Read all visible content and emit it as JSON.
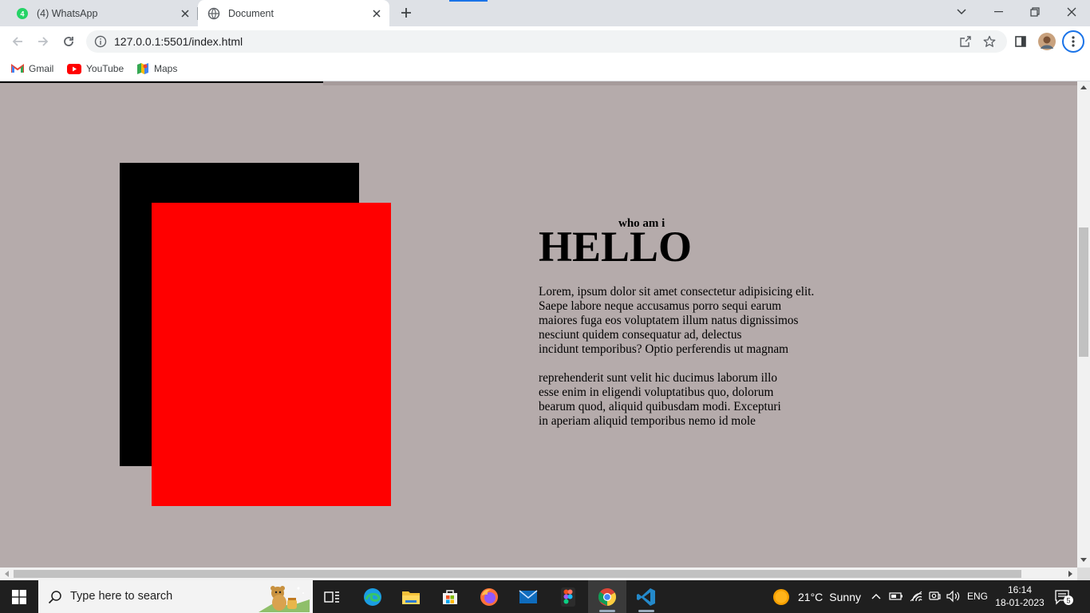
{
  "browser": {
    "tabs": [
      {
        "label": "(4) WhatsApp",
        "icon": "whatsapp-icon",
        "active": false
      },
      {
        "label": "Document",
        "icon": "globe-icon",
        "active": true
      }
    ],
    "url": "127.0.0.1:5501/index.html",
    "bookmarks": [
      {
        "label": "Gmail",
        "icon": "gmail-icon"
      },
      {
        "label": "YouTube",
        "icon": "youtube-icon"
      },
      {
        "label": "Maps",
        "icon": "maps-icon"
      }
    ]
  },
  "page": {
    "background": "#b5abab",
    "box_back_color": "#000000",
    "box_front_color": "#ff0000",
    "subtitle": "who am i",
    "headline": "HELLO",
    "paragraph1": "Lorem, ipsum dolor sit amet consectetur adipisicing elit.\nSaepe labore neque accusamus porro sequi earum\nmaiores fuga eos voluptatem illum natus dignissimos\nnesciunt quidem consequatur ad, delectus\nincidunt temporibus? Optio perferendis ut magnam",
    "paragraph2": "reprehenderit sunt velit hic ducimus laborum illo\nesse enim in eligendi voluptatibus quo, dolorum\nbearum quod, aliquid quibusdam modi. Excepturi\nin aperiam aliquid temporibus nemo id mole"
  },
  "taskbar": {
    "search_placeholder": "Type here to search",
    "apps": [
      "task-view-icon",
      "edge-icon",
      "file-explorer-icon",
      "store-icon",
      "firefox-icon",
      "mail-icon",
      "figma-icon",
      "chrome-icon",
      "vscode-icon"
    ],
    "weather_temp": "21°C",
    "weather_condition": "Sunny",
    "language": "ENG",
    "time": "16:14",
    "date": "18-01-2023",
    "notification_count": "5"
  }
}
